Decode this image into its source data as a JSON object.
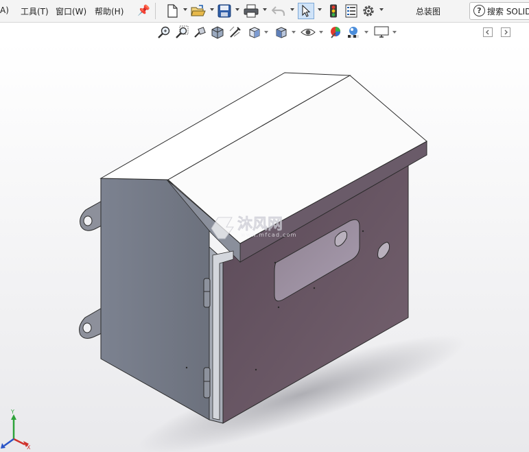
{
  "menu": {
    "partial_left": "А)",
    "tools": "工具(T)",
    "window": "窗口(W)",
    "help": "帮助(H)"
  },
  "toolbar": {
    "icons": [
      "new-document-icon",
      "open-icon",
      "save-icon",
      "print-icon",
      "undo-icon",
      "select-icon",
      "rebuild-icon",
      "file-properties-icon",
      "options-icon"
    ]
  },
  "document": {
    "title": "总装图"
  },
  "search": {
    "text": "搜索 SOLIDW"
  },
  "watermark": {
    "brand": "沐风网",
    "url": "www.mfcad.com"
  },
  "triad": {
    "x": "X",
    "y": "Y",
    "z": "Z"
  },
  "colors": {
    "viewport_top": "#ffffff",
    "viewport_bottom": "#e9e9ec",
    "box_front": "#6a5867",
    "box_side": "#7a7f8c",
    "box_roof": "#ffffff",
    "accent_blue": "#1d5fb0"
  }
}
